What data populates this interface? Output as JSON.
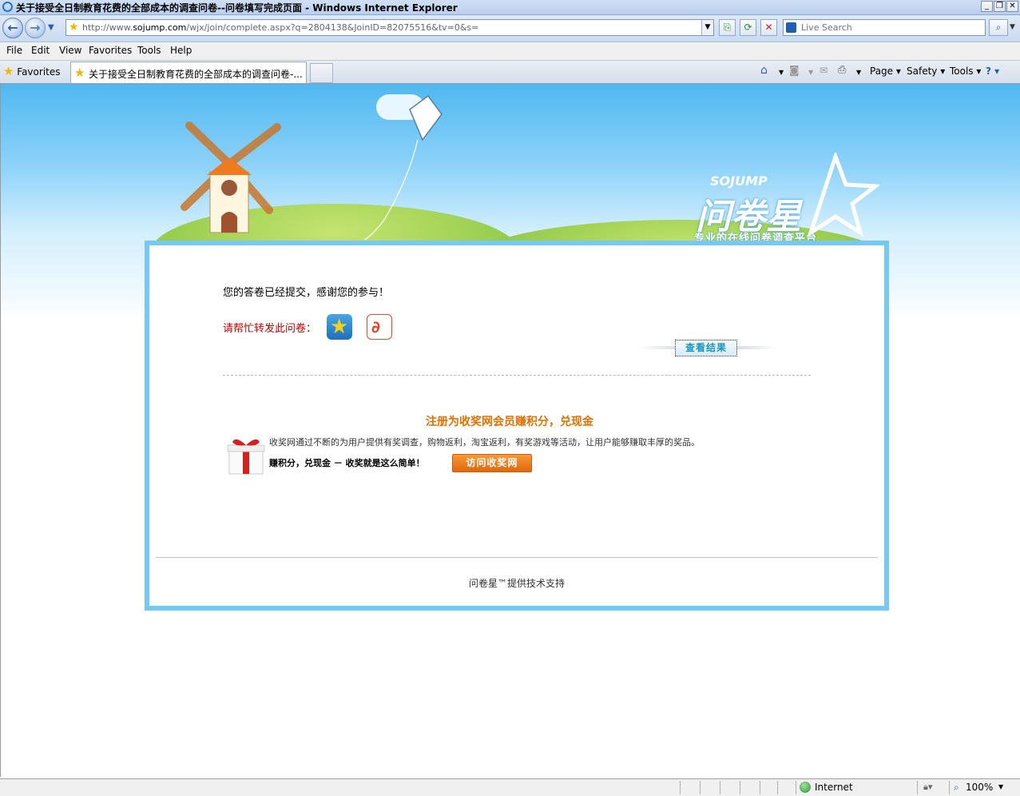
{
  "window": {
    "title": "关于接受全日制教育花费的全部成本的调查问卷--问卷填写完成页面 - Windows Internet Explorer",
    "controls": {
      "minimize": "_",
      "restore": "❐",
      "close": "✕"
    }
  },
  "navbar": {
    "back_icon": "←",
    "forward_icon": "→",
    "url_prefix": "http://www.",
    "url_domain": "sojump.com",
    "url_rest": "/wjx/join/complete.aspx?q=2804138&JoinID=82075516&tv=0&s=",
    "search_placeholder": "Live Search"
  },
  "menu": {
    "file": "File",
    "edit": "Edit",
    "view": "View",
    "favorites": "Favorites",
    "tools": "Tools",
    "help": "Help"
  },
  "tabs": {
    "favorites_label": "Favorites",
    "active_tab": "关于接受全日制教育花费的全部成本的调查问卷-...",
    "commands": {
      "page": "Page ▾",
      "safety": "Safety ▾",
      "tools": "Tools ▾",
      "help": "? ▾"
    }
  },
  "banner": {
    "brand_latin": "SOJUMP",
    "brand_cn": "问卷星",
    "tagline": "专业的在线问卷调查平台"
  },
  "content": {
    "thanks": "您的答卷已经提交，感谢您的参与！",
    "share_label": "请帮忙转发此问卷：",
    "view_results": "查看结果",
    "promo_title": "注册为收奖网会员赚积分，兑现金",
    "promo_desc": "收奖网通过不断的为用户提供有奖调查，购物返利，淘宝返利，有奖游戏等活动，让用户能够赚取丰厚的奖品。",
    "promo_slogan": "赚积分，兑现金 － 收奖就是这么简单！",
    "visit_button": "访问收奖网",
    "footer": "问卷星™提供技术支持"
  },
  "status": {
    "zone": "Internet",
    "zoom": "100%"
  },
  "colors": {
    "accent_blue": "#75c9f4",
    "promo_orange": "#e07000",
    "share_red": "#c00000"
  }
}
